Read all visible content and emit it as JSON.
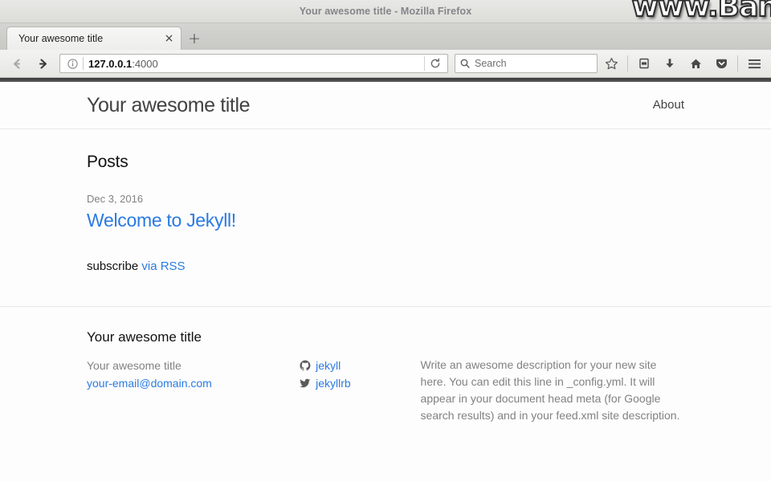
{
  "browser": {
    "title_bar": "Your awesome title - Mozilla Firefox",
    "watermark": "www.Ban",
    "tab": {
      "title": "Your awesome title",
      "close_label": "×"
    },
    "new_tab_label": "+",
    "url": {
      "host": "127.0.0.1",
      "port": ":4000"
    },
    "search_placeholder": "Search",
    "icons": {
      "back": "back-arrow-icon",
      "forward": "forward-arrow-icon",
      "info": "page-info-icon",
      "reload": "reload-icon",
      "search": "search-icon",
      "bookmark": "star-icon",
      "library": "library-icon",
      "downloads": "download-arrow-icon",
      "home": "home-icon",
      "pocket": "pocket-icon",
      "menu": "hamburger-menu-icon"
    }
  },
  "site": {
    "header": {
      "title": "Your awesome title",
      "nav": [
        {
          "label": "About"
        }
      ]
    },
    "main": {
      "posts_heading": "Posts",
      "posts": [
        {
          "date": "Dec 3, 2016",
          "title": "Welcome to Jekyll!"
        }
      ],
      "rss": {
        "prefix": "subscribe ",
        "link_label": "via RSS"
      }
    },
    "footer": {
      "heading": "Your awesome title",
      "contact": [
        {
          "label": "Your awesome title",
          "is_link": false
        },
        {
          "label": "your-email@domain.com",
          "is_link": true
        }
      ],
      "social": [
        {
          "icon": "github-icon",
          "label": "jekyll"
        },
        {
          "icon": "twitter-icon",
          "label": "jekyllrb"
        }
      ],
      "description": "Write an awesome description for your new site here. You can edit this line in _config.yml. It will appear in your document head meta (for Google search results) and in your feed.xml site description."
    }
  },
  "colors": {
    "link": "#2a7ae2",
    "muted": "#828282",
    "text": "#111111",
    "page_bg": "#fdfdfd"
  }
}
